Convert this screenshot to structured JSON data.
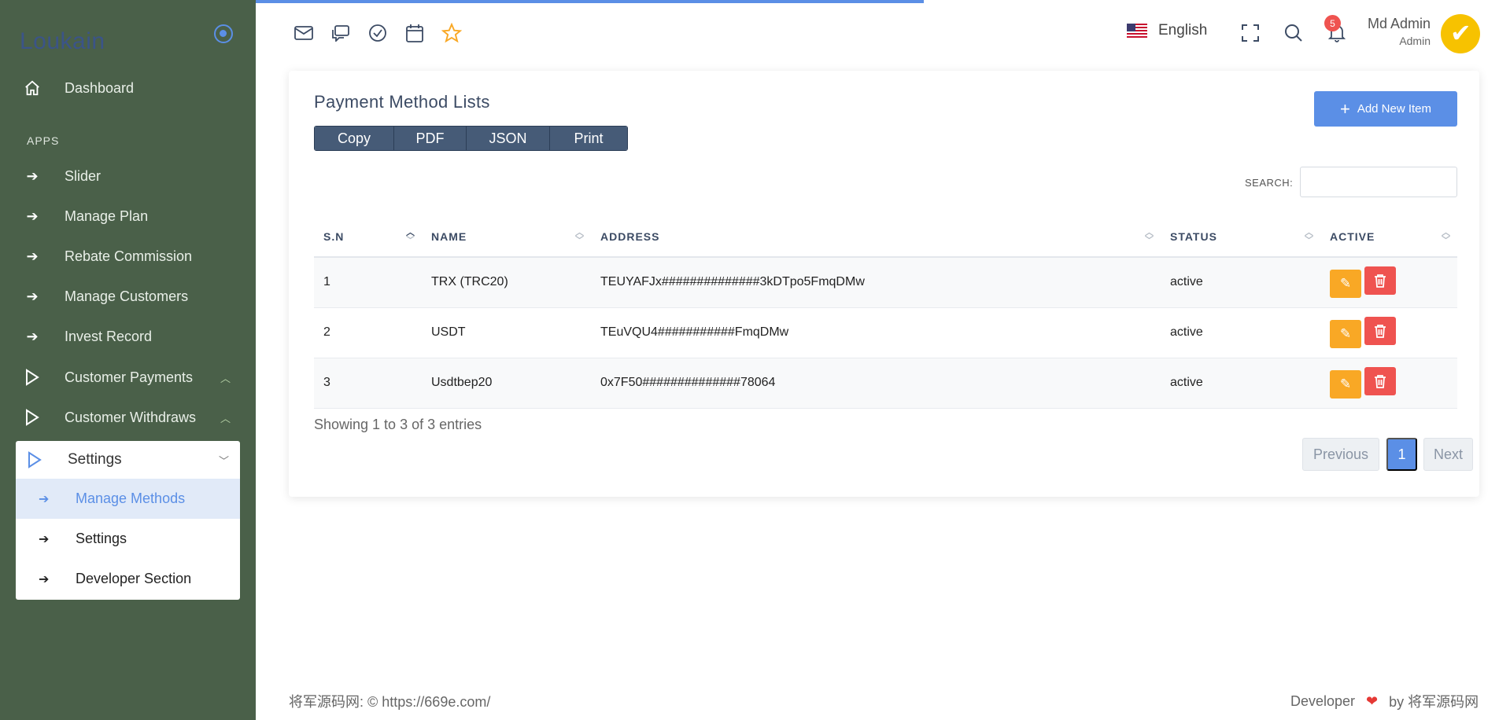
{
  "app": {
    "brand": "Loukain"
  },
  "sidebar": {
    "dashboard": "Dashboard",
    "section_label": "APPS",
    "items": [
      {
        "label": "Slider"
      },
      {
        "label": "Manage Plan"
      },
      {
        "label": "Rebate Commission"
      },
      {
        "label": "Manage Customers"
      },
      {
        "label": "Invest Record"
      },
      {
        "label": "Customer Payments"
      },
      {
        "label": "Customer Withdraws"
      }
    ],
    "settings_group": {
      "label": "Settings",
      "children": [
        {
          "label": "Manage Methods",
          "active": true
        },
        {
          "label": "Settings"
        },
        {
          "label": "Developer Section"
        }
      ]
    }
  },
  "header": {
    "icons": [
      "mail-icon",
      "chat-icon",
      "check-circle-icon",
      "calendar-icon",
      "star-icon"
    ],
    "language": "English",
    "notification_count": "5",
    "user_name": "Md Admin",
    "user_role": "Admin"
  },
  "card": {
    "title": "Payment Method Lists",
    "export_buttons": [
      "Copy",
      "PDF",
      "JSON",
      "Print"
    ],
    "add_button": "Add New Item",
    "search_label": "SEARCH:",
    "search_value": "",
    "columns": [
      "S.N",
      "NAME",
      "ADDRESS",
      "STATUS",
      "ACTIVE"
    ],
    "rows": [
      {
        "sn": "1",
        "name": "TRX (TRC20)",
        "address": "TEUYAFJx##############3kDTpo5FmqDMw",
        "status": "active"
      },
      {
        "sn": "2",
        "name": "USDT",
        "address": "TEuVQU4###########FmqDMw",
        "status": "active"
      },
      {
        "sn": "3",
        "name": "Usdtbep20",
        "address": "0x7F50##############78064",
        "status": "active"
      }
    ],
    "showing": "Showing 1 to 3 of 3 entries",
    "pagination": {
      "previous": "Previous",
      "current": "1",
      "next": "Next"
    }
  },
  "footer": {
    "left": "将军源码网: © https://669e.com/",
    "right_prefix": "Developer",
    "right_suffix": "by 将军源码网"
  },
  "colors": {
    "sidebar": "#4a6049",
    "accent": "#5b8fe6",
    "edit": "#f9a825",
    "delete": "#ef5350",
    "export_btn": "#465b77"
  }
}
